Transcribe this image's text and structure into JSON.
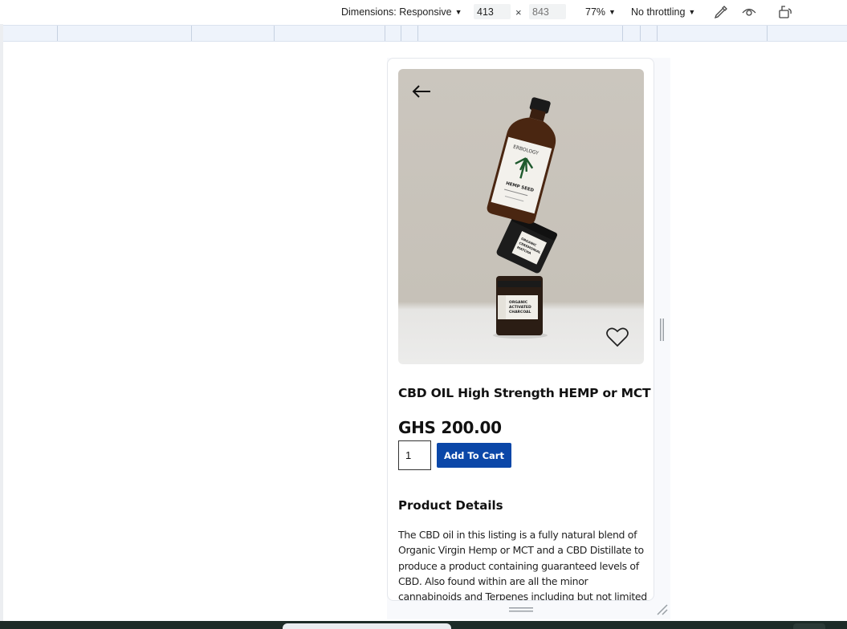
{
  "devtools": {
    "dimensions_label": "Dimensions: Responsive",
    "width_value": "413",
    "height_placeholder": "843",
    "times_sign": "×",
    "zoom": "77%",
    "throttling": "No throttling",
    "icons": [
      "eyedropper-icon",
      "eye-icon",
      "rotate-device-icon"
    ]
  },
  "product": {
    "image_label_bottle": "HEMP SEED",
    "brand": "ERBOLOGY",
    "jar_label": "ORGANIC ACTIVATED CHARCOAL",
    "title": "CBD OIL High Strength HEMP or MCT",
    "price": "GHS 200.00",
    "quantity": "1",
    "add_to_cart": "Add To Cart",
    "details_heading": "Product Details",
    "details_text": "The CBD oil in this listing is a fully natural blend of Organic Virgin Hemp or MCT and a CBD Distillate to produce a product containing guaranteed levels of CBD. Also found within are all the minor cannabinoids and Terpenes including but not limited to CBG, CBDa"
  },
  "colors": {
    "button": "#0b47a8",
    "ruler": "#eef3fb"
  }
}
